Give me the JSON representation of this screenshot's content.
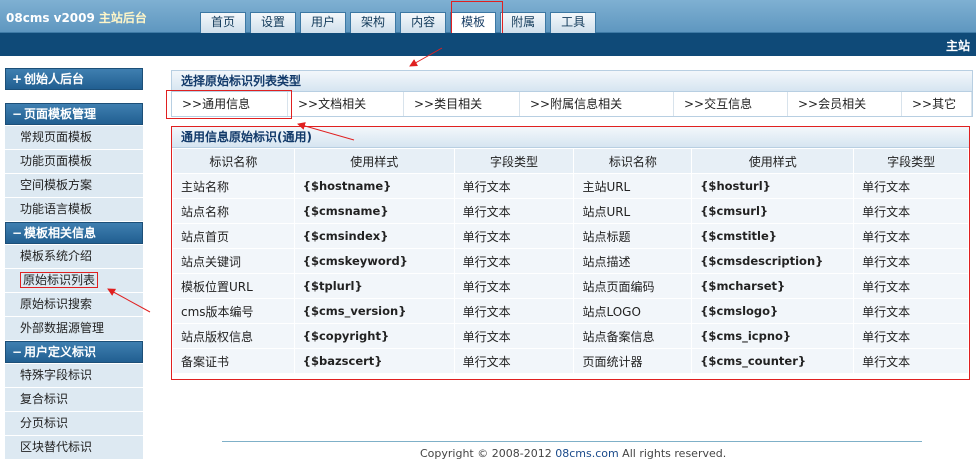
{
  "header": {
    "logo": "08cms  v2009",
    "site_label": "主站后台",
    "tabs": [
      "首页",
      "设置",
      "用户",
      "架构",
      "内容",
      "模板",
      "附属",
      "工具"
    ],
    "active_tab": "模板",
    "sub_right": "主站"
  },
  "sidebar": {
    "sections": [
      {
        "symbol": "+",
        "title": "创始人后台",
        "items": []
      },
      {
        "symbol": "−",
        "title": "页面模板管理",
        "items": [
          "常规页面模板",
          "功能页面模板",
          "空间模板方案",
          "功能语言模板"
        ]
      },
      {
        "symbol": "−",
        "title": "模板相关信息",
        "items": [
          "模板系统介绍",
          "原始标识列表",
          "原始标识搜索",
          "外部数据源管理"
        ]
      },
      {
        "symbol": "−",
        "title": "用户定义标识",
        "items": [
          "特殊字段标识",
          "复合标识",
          "分页标识",
          "区块替代标识"
        ]
      }
    ],
    "selected_item": "原始标识列表"
  },
  "type_panel": {
    "title": "选择原始标识列表类型",
    "types": [
      ">>通用信息",
      ">>文档相关",
      ">>类目相关",
      ">>附属信息相关",
      ">>交互信息",
      ">>会员相关",
      ">>其它"
    ]
  },
  "tag_panel": {
    "title": "通用信息原始标识(通用)",
    "headers": [
      "标识名称",
      "使用样式",
      "字段类型",
      "标识名称",
      "使用样式",
      "字段类型"
    ],
    "rows": [
      [
        "主站名称",
        "{$hostname}",
        "单行文本",
        "主站URL",
        "{$hosturl}",
        "单行文本"
      ],
      [
        "站点名称",
        "{$cmsname}",
        "单行文本",
        "站点URL",
        "{$cmsurl}",
        "单行文本"
      ],
      [
        "站点首页",
        "{$cmsindex}",
        "单行文本",
        "站点标题",
        "{$cmstitle}",
        "单行文本"
      ],
      [
        "站点关键词",
        "{$cmskeyword}",
        "单行文本",
        "站点描述",
        "{$cmsdescription}",
        "单行文本"
      ],
      [
        "模板位置URL",
        "{$tplurl}",
        "单行文本",
        "站点页面编码",
        "{$mcharset}",
        "单行文本"
      ],
      [
        "cms版本编号",
        "{$cms_version}",
        "单行文本",
        "站点LOGO",
        "{$cmslogo}",
        "单行文本"
      ],
      [
        "站点版权信息",
        "{$copyright}",
        "单行文本",
        "站点备案信息",
        "{$cms_icpno}",
        "单行文本"
      ],
      [
        "备案证书",
        "{$bazscert}",
        "单行文本",
        "页面统计器",
        "{$cms_counter}",
        "单行文本"
      ]
    ]
  },
  "footer": {
    "prefix": "Copyright © 2008-2012 ",
    "link": "08cms.com",
    "suffix": " All rights reserved."
  },
  "colors": {
    "header": "#5f97c0",
    "subbar": "#0f4a78",
    "highlight": "#e02020"
  }
}
